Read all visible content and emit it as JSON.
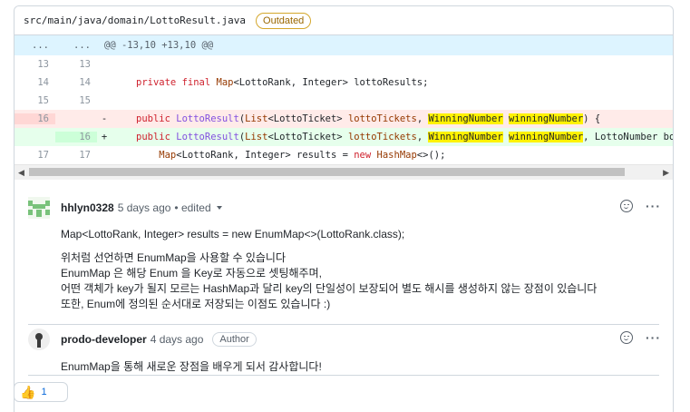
{
  "file": {
    "path": "src/main/java/domain/LottoResult.java",
    "status_badge": "Outdated"
  },
  "diff": {
    "hunk": {
      "left": "...",
      "right": "...",
      "text": "@@ -13,10 +13,10 @@"
    },
    "lines": [
      {
        "type": "ctx",
        "old": "13",
        "new": "13",
        "marker": "",
        "segments": []
      },
      {
        "type": "ctx",
        "old": "14",
        "new": "14",
        "marker": "",
        "segments": [
          {
            "t": "private final ",
            "c": "kw"
          },
          {
            "t": "Map",
            "c": "ty"
          },
          {
            "t": "<LottoRank, Integer> lottoResults;",
            "c": ""
          }
        ]
      },
      {
        "type": "ctx",
        "old": "15",
        "new": "15",
        "marker": "",
        "segments": []
      },
      {
        "type": "del",
        "old": "16",
        "new": "",
        "marker": "-",
        "segments": [
          {
            "t": "public ",
            "c": "kw"
          },
          {
            "t": "LottoResult",
            "c": "mt"
          },
          {
            "t": "(",
            "c": ""
          },
          {
            "t": "List",
            "c": "ty"
          },
          {
            "t": "<LottoTicket> ",
            "c": ""
          },
          {
            "t": "lottoTickets",
            "c": "ty"
          },
          {
            "t": ", ",
            "c": ""
          },
          {
            "t": "WinningNumber",
            "c": "hl"
          },
          {
            "t": " ",
            "c": ""
          },
          {
            "t": "winningNumber",
            "c": "hl"
          },
          {
            "t": ") {",
            "c": ""
          }
        ]
      },
      {
        "type": "add",
        "old": "",
        "new": "16",
        "marker": "+",
        "segments": [
          {
            "t": "public ",
            "c": "kw"
          },
          {
            "t": "LottoResult",
            "c": "mt"
          },
          {
            "t": "(",
            "c": ""
          },
          {
            "t": "List",
            "c": "ty"
          },
          {
            "t": "<LottoTicket> ",
            "c": ""
          },
          {
            "t": "lottoTickets",
            "c": "ty"
          },
          {
            "t": ", ",
            "c": ""
          },
          {
            "t": "WinningNumber",
            "c": "hl"
          },
          {
            "t": " ",
            "c": ""
          },
          {
            "t": "winningNumber",
            "c": "hl"
          },
          {
            "t": ", LottoNumber bonusBal",
            "c": ""
          }
        ]
      },
      {
        "type": "ctx",
        "old": "17",
        "new": "17",
        "marker": "",
        "segments": [
          {
            "t": "    Map",
            "c": "ty"
          },
          {
            "t": "<LottoRank, Integer> results = ",
            "c": ""
          },
          {
            "t": "new ",
            "c": "kw"
          },
          {
            "t": "HashMap",
            "c": "ty"
          },
          {
            "t": "<>();",
            "c": ""
          }
        ]
      }
    ]
  },
  "comments": [
    {
      "author": "hhlyn0328",
      "time": "5 days ago",
      "edited": "• edited",
      "lines": [
        "Map<LottoRank, Integer> results = new EnumMap<>(LottoRank.class);",
        "",
        "위처럼 선언하면 EnumMap을 사용할 수 있습니다",
        "EnumMap 은 해당 Enum 을 Key로 자동으로 셋팅해주며,",
        "어떤 객체가 key가 될지 모르는 HashMap과 달리 key의 단일성이 보장되어 별도 해시를 생성하지 않는 장점이 있습니다",
        "또한, Enum에 정의된 순서대로 저장되는 이점도 있습니다 :)"
      ]
    },
    {
      "author": "prodo-developer",
      "time": "4 days ago",
      "badge": "Author",
      "lines": [
        "EnumMap을 통해 새로운 장점을 배우게 되서 감사합니다!"
      ]
    }
  ],
  "reaction": {
    "emoji": "👍",
    "count": "1"
  },
  "colors": {
    "outdated": "#9a6700",
    "del_bg": "#ffebe9",
    "add_bg": "#e6ffec",
    "hunk_bg": "#ddf4ff",
    "highlight": "#fff200"
  }
}
